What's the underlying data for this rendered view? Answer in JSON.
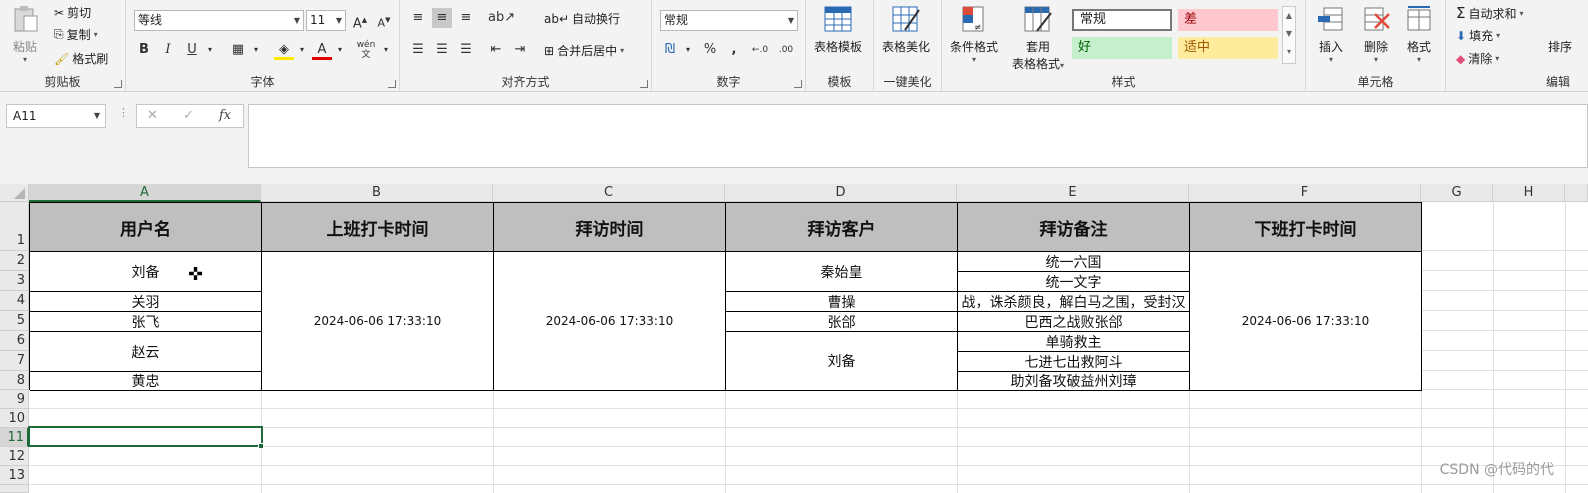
{
  "ribbon": {
    "clipboard": {
      "label": "剪贴板",
      "paste": "粘贴",
      "cut": "剪切",
      "copy": "复制",
      "format_painter": "格式刷"
    },
    "font": {
      "label": "字体",
      "name": "等线",
      "size": "11",
      "bold": "B",
      "italic": "I",
      "underline": "U",
      "phonetic": "wén"
    },
    "alignment": {
      "label": "对齐方式",
      "wrap": "自动换行",
      "merge": "合并后居中"
    },
    "number": {
      "label": "数字",
      "format": "常规",
      "percent": "%",
      "comma": ","
    },
    "template": {
      "label": "模板",
      "button": "表格模板"
    },
    "beautify": {
      "label": "一键美化",
      "button": "表格美化"
    },
    "styles": {
      "label": "样式",
      "conditional": "条件格式",
      "as_table_1": "套用",
      "as_table_2": "表格格式",
      "normal": "常规",
      "bad": "差",
      "good": "好",
      "neutral": "适中",
      "colors": {
        "bad_bg": "#ffc7ce",
        "bad_fg": "#9c0006",
        "good_bg": "#c6efce",
        "good_fg": "#006100",
        "neutral_bg": "#ffeb9c",
        "neutral_fg": "#9c5700"
      }
    },
    "cells": {
      "label": "单元格",
      "insert": "插入",
      "delete": "删除",
      "format": "格式"
    },
    "editing": {
      "label": "编辑",
      "autosum": "自动求和",
      "fill": "填充",
      "clear": "清除",
      "sort": "排序"
    }
  },
  "formula_bar": {
    "name_box": "A11",
    "cancel": "✕",
    "enter": "✓",
    "fx": "fx",
    "content": ""
  },
  "sheet": {
    "columns": [
      "A",
      "B",
      "C",
      "D",
      "E",
      "F",
      "G",
      "H"
    ],
    "rows": [
      "1",
      "2",
      "3",
      "4",
      "5",
      "6",
      "7",
      "8",
      "9",
      "10",
      "11",
      "12",
      "13"
    ],
    "active_cell": "A11",
    "headers": [
      "用户名",
      "上班打卡时间",
      "拜访时间",
      "拜访客户",
      "拜访备注",
      "下班打卡时间"
    ],
    "users": [
      "刘备",
      "关羽",
      "张飞",
      "赵云",
      "黄忠"
    ],
    "checkin": "2024-06-06 17:33:10",
    "visit_time": "2024-06-06 17:33:10",
    "clients": [
      "秦始皇",
      "曹操",
      "张郃",
      "刘备"
    ],
    "notes": [
      "统一六国",
      "统一文字",
      "战，诛杀颜良，解白马之围，受封汉",
      "巴西之战败张郃",
      "单骑救主",
      "七进七出救阿斗",
      "助刘备攻破益州刘璋"
    ],
    "checkout": "2024-06-06 17:33:10"
  },
  "watermark": "CSDN @代码的代"
}
